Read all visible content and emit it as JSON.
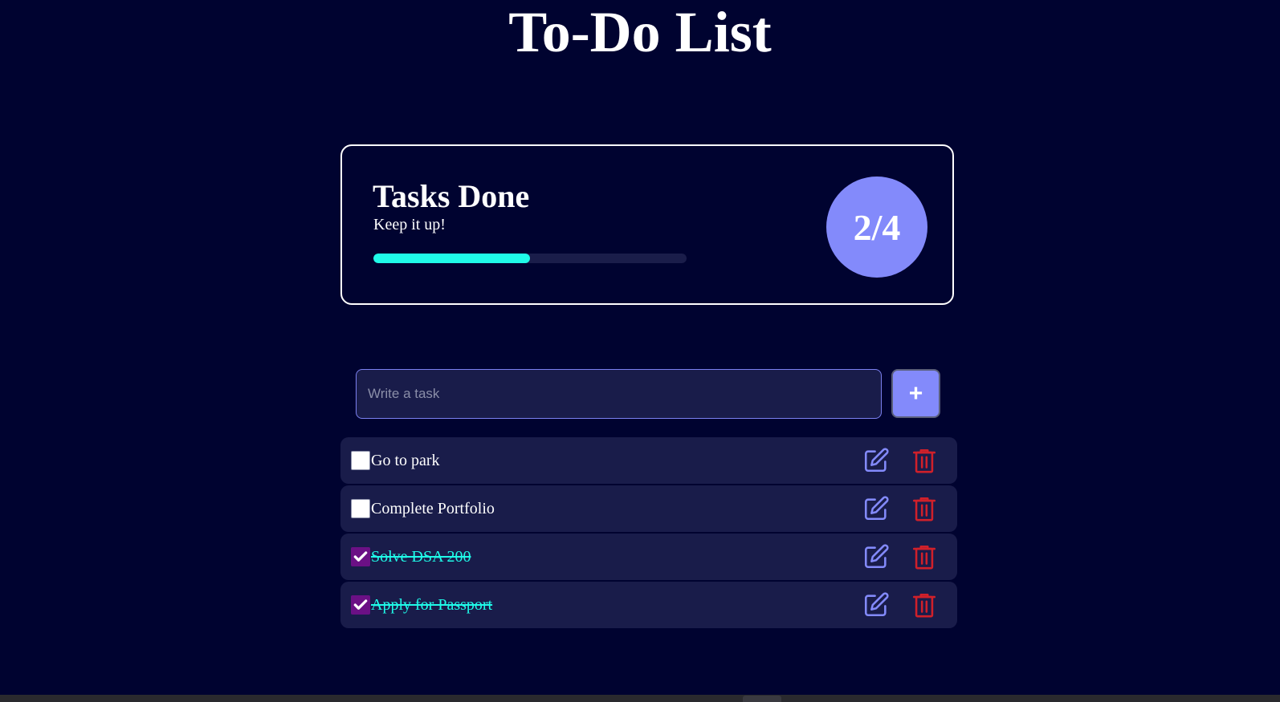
{
  "header": {
    "title": "To-Do List"
  },
  "stats": {
    "heading": "Tasks Done",
    "subtitle": "Keep it up!",
    "counter": "2/4",
    "progress": 0.5,
    "colors": {
      "progress_fill": "#1ffbe8",
      "counter_bg": "#838afb"
    }
  },
  "composer": {
    "placeholder": "Write a task",
    "value": "",
    "add_label": "+"
  },
  "tasks": [
    {
      "text": "Go to park",
      "done": false
    },
    {
      "text": "Complete Portfolio",
      "done": false
    },
    {
      "text": "Solve DSA 200",
      "done": true
    },
    {
      "text": "Apply for Passport",
      "done": true
    }
  ],
  "icons": {
    "edit": "edit-icon",
    "delete": "trash-icon",
    "check": "check-icon"
  },
  "colors": {
    "background": "#000330",
    "accent": "#838afb",
    "done_text": "#1ffbe8",
    "delete": "#d0202a",
    "checkbox_checked": "#6b1085"
  }
}
